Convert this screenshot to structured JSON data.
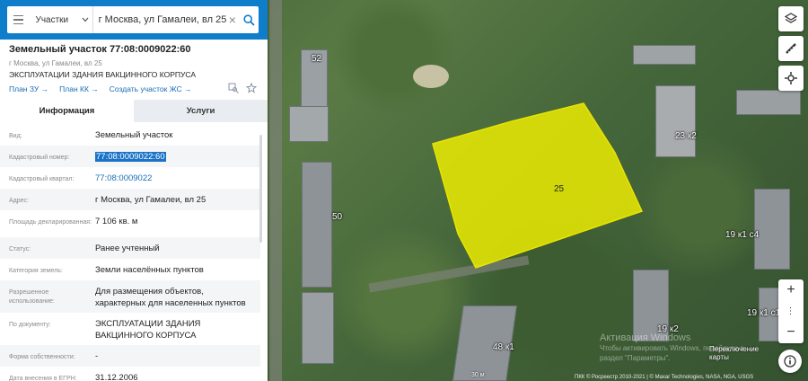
{
  "search": {
    "layer": "Участки",
    "value": "г Москва, ул Гамалеи, вл 25",
    "clear": "×"
  },
  "object": {
    "title": "Земельный участок 77:08:0009022:60",
    "address": "г Москва, ул Гамалеи, вл 25",
    "purpose": "ЭКСПЛУАТАЦИИ ЗДАНИЯ ВАКЦИННОГО КОРПУСА",
    "links": [
      "План ЗУ →",
      "План КК →",
      "Создать участок ЖС →"
    ]
  },
  "tabs": [
    "Информация",
    "Услуги"
  ],
  "info": [
    {
      "key": "Вид:",
      "value": "Земельный участок"
    },
    {
      "key": "Кадастровый номер:",
      "value": "77:08:0009022:60"
    },
    {
      "key": "Кадастровый квартал:",
      "value": "77:08:0009022"
    },
    {
      "key": "Адрес:",
      "value": "г Москва, ул Гамалеи, вл 25"
    },
    {
      "key": "Площадь декларированная:",
      "value": "7 106 кв. м"
    },
    {
      "key": "Статус:",
      "value": "Ранее учтенный"
    },
    {
      "key": "Категория земель:",
      "value": "Земли населённых пунктов"
    },
    {
      "key": "Разрешенное использование:",
      "value": "Для размещения объектов, характерных для населенных пунктов"
    },
    {
      "key": "По документу:",
      "value": "ЭКСПЛУАТАЦИИ ЗДАНИЯ ВАКЦИННОГО КОРПУСА"
    },
    {
      "key": "Форма собственности:",
      "value": "-"
    },
    {
      "key": "Дата внесения в ЕГРН:",
      "value": "31.12.2006"
    }
  ],
  "map_labels": {
    "b52": "52",
    "b50": "50",
    "b25": "25",
    "b23k2": "23 к2",
    "b19k1c4": "19 к1 с4",
    "b19k1c1": "19 к1 с1",
    "b19k2": "19 к2",
    "b48k1": "48 к1"
  },
  "controls": {
    "zoom_in": "+",
    "zoom_out": "−",
    "switch_map": "Переключение карты"
  },
  "watermark": {
    "line1": "Активация Windows",
    "line2": "Чтобы активировать Windows, перейдите в",
    "line3": "раздел \"Параметры\"."
  },
  "scale": "30 м",
  "attribution": "ПКК © Росреестр 2010-2021 | © Maxar Technologies, NASA, NGA, USGS",
  "colors": {
    "header": "#0e7ecb",
    "link": "#1a6db6",
    "parcel_fill": "#f2f000",
    "highlight": "#1a73c6"
  }
}
